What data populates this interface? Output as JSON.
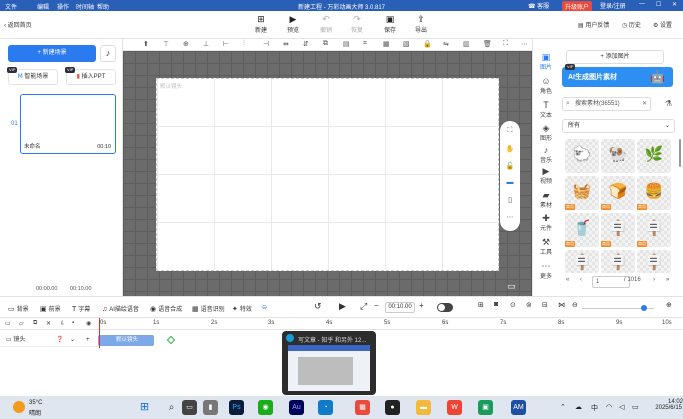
{
  "menubar": {
    "items": [
      "文件",
      "编辑",
      "操作",
      "时间轴",
      "帮助"
    ],
    "title": "新建工程 - 万彩动画大师 3.0.817",
    "service": "客服",
    "upgrade": "升级账户",
    "login": "登录/注册"
  },
  "toolbar": {
    "back": "返回首页",
    "new": "新建",
    "preview": "预览",
    "undo": "撤销",
    "redo": "恢复",
    "save": "保存",
    "export": "导出",
    "feedback": "用户反馈",
    "history": "历史",
    "settings": "设置"
  },
  "left_panel": {
    "new_scene": "+ 新建场景",
    "smart_scene": "智能场景",
    "insert_ppt": "插入PPT",
    "vip": "VIP",
    "scene_number": "01",
    "scene_name": "未命名",
    "scene_duration": "00:10",
    "time_start": "00:00.00",
    "time_end": "00:10.00"
  },
  "canvas": {
    "default_camera_label": "默认镜头"
  },
  "right_nav": {
    "items": [
      {
        "label": "图片",
        "icon": "image-icon",
        "selected": true
      },
      {
        "label": "角色",
        "icon": "character-icon",
        "selected": false
      },
      {
        "label": "文本",
        "icon": "text-icon",
        "selected": false
      },
      {
        "label": "图形",
        "icon": "shape-icon",
        "selected": false
      },
      {
        "label": "音乐",
        "icon": "music-icon",
        "selected": false
      },
      {
        "label": "视频",
        "icon": "video-icon",
        "selected": false
      },
      {
        "label": "素材",
        "icon": "material-icon",
        "selected": false
      },
      {
        "label": "元件",
        "icon": "component-icon",
        "selected": false
      },
      {
        "label": "工具",
        "icon": "tool-icon",
        "selected": false
      },
      {
        "label": "更多",
        "icon": "more-icon",
        "selected": false
      }
    ]
  },
  "right_panel": {
    "add_image": "+ 添加图片",
    "ai_banner": "AI生成图片素材",
    "search_placeholder": "搜索素材(36551)",
    "filter_all": "所有",
    "tag": "商用",
    "page_current": "1",
    "page_total": "/ 1016",
    "assets": [
      "sheep",
      "bonsai",
      "basket",
      "bread",
      "burger",
      "juice",
      "sign1",
      "sign2",
      "sign3",
      "sign4",
      "sign5",
      "sign6"
    ]
  },
  "timeline_tools": {
    "background": "背景",
    "foreground": "前景",
    "subtitle": "字幕",
    "ai_voice": "AI描绘语音",
    "voice_synth": "语音合成",
    "voice_recognition": "语音识别",
    "effects": "特效",
    "time_value": "00:10.00"
  },
  "ruler": {
    "ticks": [
      "0s",
      "1s",
      "2s",
      "3s",
      "4s",
      "5s",
      "6s",
      "7s",
      "8s",
      "9s",
      "10s"
    ]
  },
  "track": {
    "camera_label": "镜头",
    "clip_label": "默认镜头"
  },
  "preview_popup": {
    "title": "写文章 - 知乎 和另外 12..."
  },
  "taskbar": {
    "temperature": "35°C",
    "weather": "晴朗",
    "ime": "中",
    "time": "14:02",
    "date": "2025/6/15",
    "app_ps": "Ps",
    "app_au": "Au",
    "app_am": "AM"
  },
  "colors": {
    "accent": "#2b7bf0",
    "menubar": "#2a5fb8",
    "upgrade": "#e84b3c",
    "canvas_bg": "#6b6b6b",
    "tag": "#f08a24"
  }
}
